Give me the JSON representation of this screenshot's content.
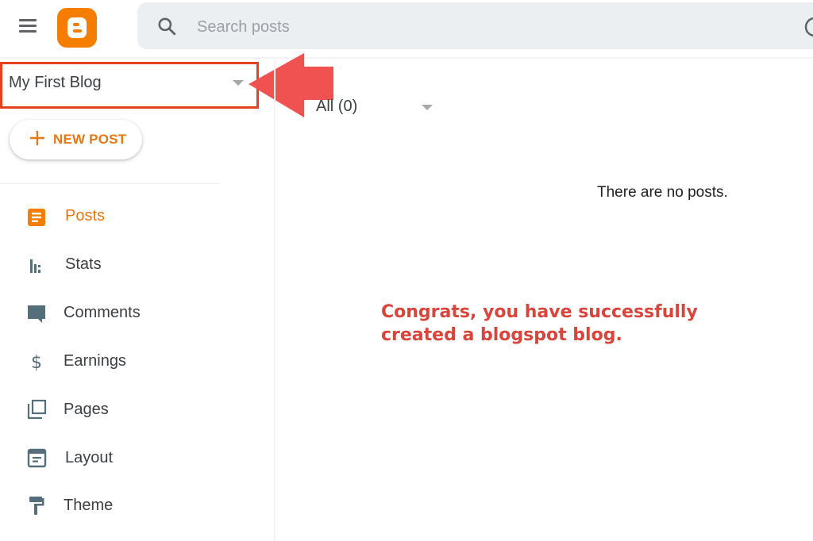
{
  "header": {
    "menu_icon": "hamburger-menu-icon",
    "logo": "blogger-logo",
    "search": {
      "placeholder": "Search posts",
      "value": "",
      "icon": "search-icon"
    },
    "right_icon": "help-circle-icon"
  },
  "blog_selector": {
    "name": "My First Blog",
    "icon": "caret-down-icon"
  },
  "annotation": {
    "arrow_color": "#f05252",
    "highlight_color": "#e8401c",
    "message_line1": "Congrats, you have successfully",
    "message_line2": "created a blogspot blog."
  },
  "new_post": {
    "label": "NEW POST",
    "icon": "plus-icon"
  },
  "sidebar": {
    "items": [
      {
        "label": "Posts",
        "icon": "posts-icon",
        "active": true
      },
      {
        "label": "Stats",
        "icon": "stats-icon",
        "active": false
      },
      {
        "label": "Comments",
        "icon": "comments-icon",
        "active": false
      },
      {
        "label": "Earnings",
        "icon": "dollar-icon",
        "active": false
      },
      {
        "label": "Pages",
        "icon": "pages-icon",
        "active": false
      },
      {
        "label": "Layout",
        "icon": "layout-icon",
        "active": false
      },
      {
        "label": "Theme",
        "icon": "paint-roller-icon",
        "active": false
      }
    ]
  },
  "main": {
    "filter": {
      "selected": "All (0)"
    },
    "empty_message": "There are no posts."
  },
  "colors": {
    "accent": "#f57d00",
    "accent_text": "#e8770f",
    "icon_gray": "#546e7a",
    "annotation_text": "#d9443b"
  }
}
